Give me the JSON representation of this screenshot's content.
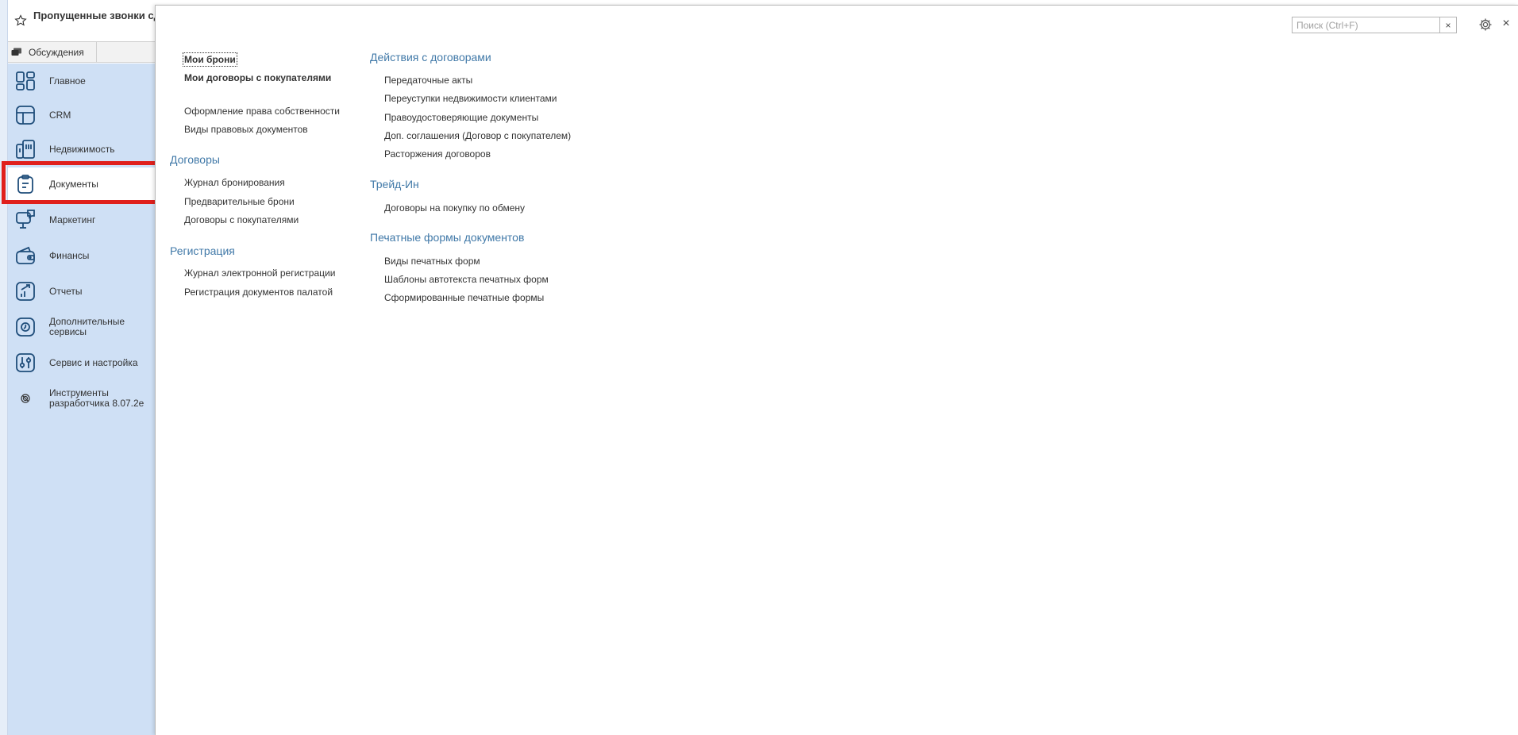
{
  "header": {
    "title": "Пропущенные звонки сде"
  },
  "discussions_tab": "Обсуждения",
  "sidebar": {
    "items": [
      {
        "label": "Главное",
        "icon": "home-grid-icon"
      },
      {
        "label": "CRM",
        "icon": "crm-layout-icon"
      },
      {
        "label": "Недвижимость",
        "icon": "buildings-icon"
      },
      {
        "label": "Документы",
        "icon": "clipboard-document-icon",
        "active": true
      },
      {
        "label": "Маркетинг",
        "icon": "monitor-chat-icon"
      },
      {
        "label": "Финансы",
        "icon": "wallet-icon"
      },
      {
        "label": "Отчеты",
        "icon": "chart-up-icon"
      },
      {
        "label": "Дополнительные сервисы",
        "icon": "services-icon"
      },
      {
        "label": "Сервис и настройка",
        "icon": "sliders-icon"
      },
      {
        "label": "Инструменты разработчика 8.07.2e",
        "icon": "developer-tools-icon"
      }
    ]
  },
  "search": {
    "placeholder": "Поиск (Ctrl+F)",
    "value": "",
    "clear": "×"
  },
  "panel": {
    "close": "×",
    "col1": {
      "top_links": [
        "Мои брони",
        "Мои договоры с покупателями"
      ],
      "mid_links": [
        "Оформление права собственности",
        "Виды правовых документов"
      ],
      "groups": [
        {
          "title": "Договоры",
          "links": [
            "Журнал бронирования",
            "Предварительные брони",
            "Договоры с покупателями"
          ]
        },
        {
          "title": "Регистрация",
          "links": [
            "Журнал электронной регистрации",
            "Регистрация документов палатой"
          ]
        }
      ]
    },
    "col2": {
      "groups": [
        {
          "title": "Действия с договорами",
          "links": [
            "Передаточные акты",
            "Переуступки недвижимости клиентами",
            "Правоудостоверяющие документы",
            "Доп. соглашения (Договор с покупателем)",
            "Расторжения договоров"
          ]
        },
        {
          "title": "Трейд-Ин",
          "links": [
            "Договоры на покупку по обмену"
          ]
        },
        {
          "title": "Печатные формы документов",
          "links": [
            "Виды печатных форм",
            "Шаблоны автотекста печатных форм",
            "Сформированные печатные формы"
          ]
        }
      ]
    }
  },
  "colors": {
    "accent_link": "#4179a8",
    "sidebar_bg": "#cfe0f5",
    "highlight": "#e0201c"
  }
}
